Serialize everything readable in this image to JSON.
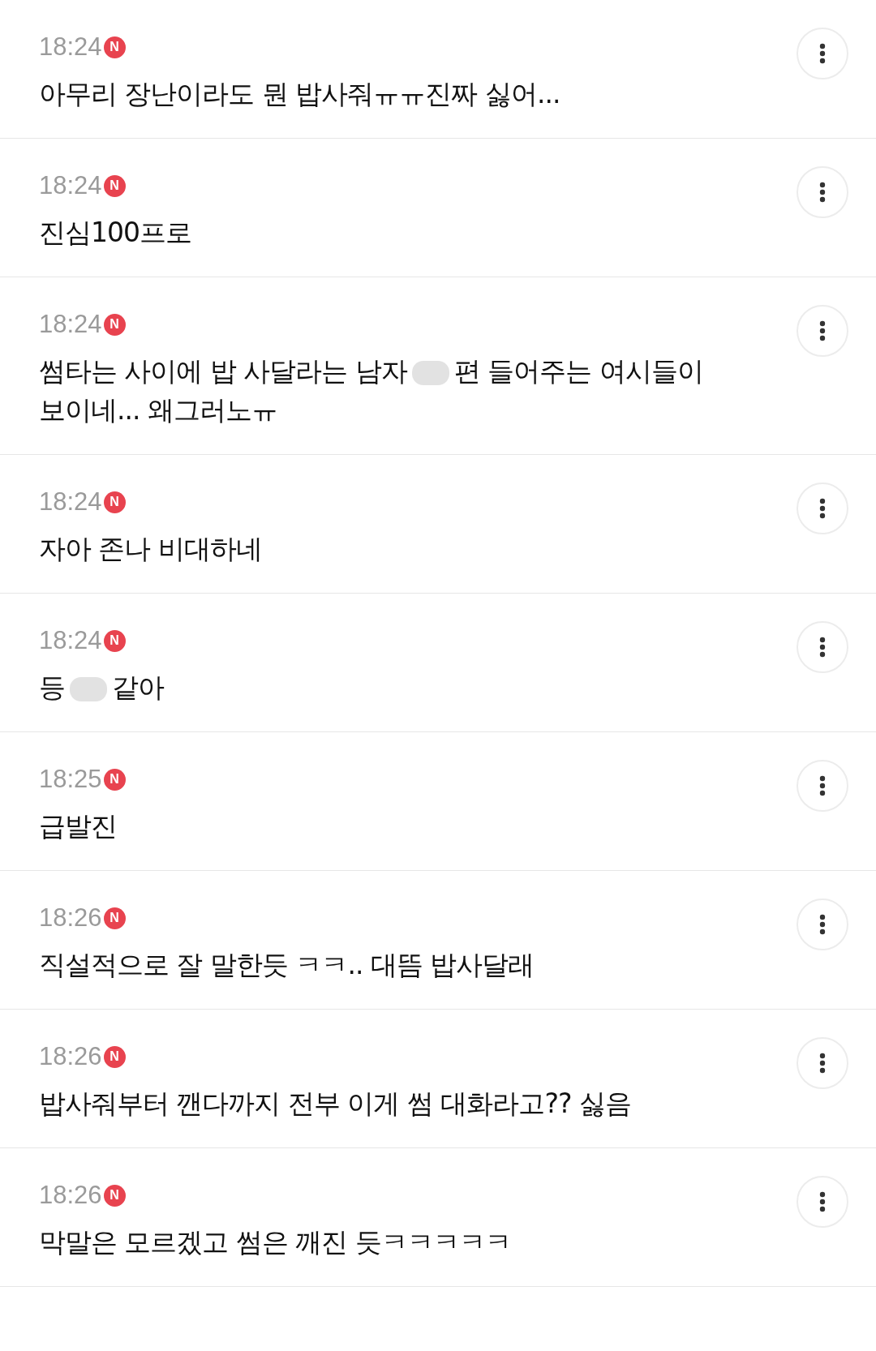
{
  "comments": [
    {
      "time": "18:24",
      "badge": "N",
      "parts": [
        {
          "kind": "text",
          "text": "아무리 장난이라도 뭔 밥사줘ㅠㅠ진짜 싫어..."
        }
      ]
    },
    {
      "time": "18:24",
      "badge": "N",
      "parts": [
        {
          "kind": "text",
          "text": "진심100프로"
        }
      ]
    },
    {
      "time": "18:24",
      "badge": "N",
      "parts": [
        {
          "kind": "text",
          "text": "썸타는 사이에 밥 사달라는 남자"
        },
        {
          "kind": "censored"
        },
        {
          "kind": "text",
          "text": "편 들어주는 여시들이 보이네... 왜그러노ㅠ"
        }
      ]
    },
    {
      "time": "18:24",
      "badge": "N",
      "parts": [
        {
          "kind": "text",
          "text": "자아 존나 비대하네"
        }
      ]
    },
    {
      "time": "18:24",
      "badge": "N",
      "parts": [
        {
          "kind": "text",
          "text": "등"
        },
        {
          "kind": "censored"
        },
        {
          "kind": "text",
          "text": "같아"
        }
      ]
    },
    {
      "time": "18:25",
      "badge": "N",
      "parts": [
        {
          "kind": "text",
          "text": "급발진"
        }
      ]
    },
    {
      "time": "18:26",
      "badge": "N",
      "parts": [
        {
          "kind": "text",
          "text": "직설적으로 잘 말한듯 ㅋㅋ.. 대뜸 밥사달래"
        }
      ]
    },
    {
      "time": "18:26",
      "badge": "N",
      "parts": [
        {
          "kind": "text",
          "text": "밥사줘부터 깬다까지 전부 이게 썸 대화라고?? 싫음"
        }
      ]
    },
    {
      "time": "18:26",
      "badge": "N",
      "parts": [
        {
          "kind": "text",
          "text": "막말은 모르겠고 썸은 깨진 듯ㅋㅋㅋㅋㅋ"
        }
      ]
    }
  ]
}
